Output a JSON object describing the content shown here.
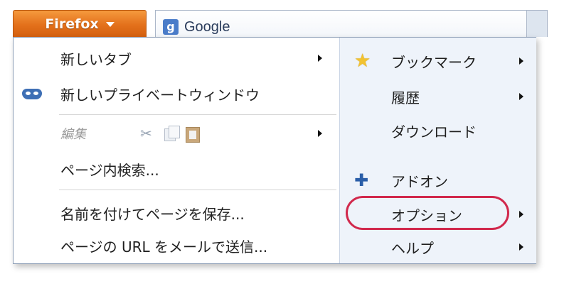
{
  "toolbar": {
    "firefox_label": "Firefox",
    "search_text": "Google",
    "search_icon_letter": "g"
  },
  "menu": {
    "left": [
      {
        "label": "新しいタブ"
      },
      {
        "label": "新しいプライベートウィンドウ"
      },
      {
        "label": "編集"
      },
      {
        "label": "ページ内検索..."
      },
      {
        "label": "名前を付けてページを保存..."
      },
      {
        "label": "ページの URL をメールで送信..."
      }
    ],
    "right": [
      {
        "label": "ブックマーク"
      },
      {
        "label": "履歴"
      },
      {
        "label": "ダウンロード"
      },
      {
        "label": "アドオン"
      },
      {
        "label": "オプション"
      },
      {
        "label": "ヘルプ"
      }
    ]
  },
  "colors": {
    "firefox_button": "#e3701b",
    "highlight_ring": "#d1284c",
    "right_column_bg": "#eef3fa"
  }
}
